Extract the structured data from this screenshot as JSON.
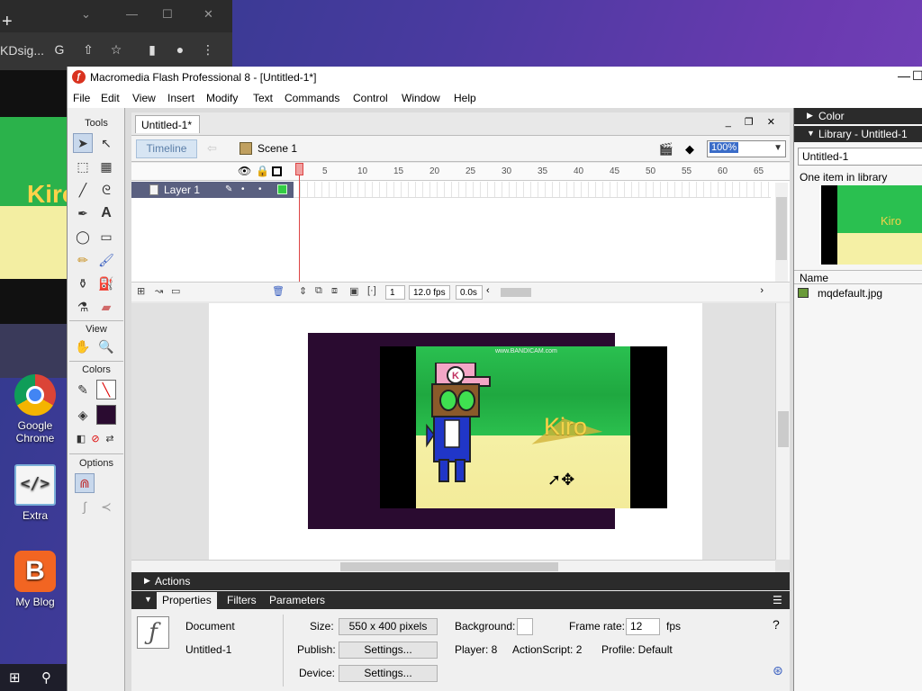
{
  "browser": {
    "url_fragment": "KDsig...",
    "new_tab": "+"
  },
  "desktop": {
    "icons": [
      {
        "label": "Google Chrome"
      },
      {
        "label": "Extra"
      },
      {
        "label": "My Blog"
      }
    ]
  },
  "window": {
    "title": "Macromedia Flash Professional 8 - [Untitled-1*]"
  },
  "menu": [
    "File",
    "Edit",
    "View",
    "Insert",
    "Modify",
    "Text",
    "Commands",
    "Control",
    "Window",
    "Help"
  ],
  "tools": {
    "header": "Tools",
    "view_header": "View",
    "colors_header": "Colors",
    "options_header": "Options"
  },
  "document": {
    "tab": "Untitled-1*",
    "timeline_button": "Timeline",
    "scene": "Scene 1",
    "zoom": "100%"
  },
  "timeline": {
    "ruler": [
      "5",
      "10",
      "15",
      "20",
      "25",
      "30",
      "35",
      "40",
      "45",
      "50",
      "55",
      "60",
      "65"
    ],
    "layer_name": "Layer 1",
    "current_frame": "1",
    "frame_rate": "12.0 fps",
    "elapsed": "0.0s"
  },
  "stage": {
    "watermark": "www.BANDICAM.com",
    "video_text": "Kiro"
  },
  "panels": {
    "actions": "Actions",
    "tabs": [
      "Properties",
      "Filters",
      "Parameters"
    ]
  },
  "properties": {
    "doc_label": "Document",
    "doc_name": "Untitled-1",
    "size_label": "Size:",
    "size_value": "550 x 400 pixels",
    "background_label": "Background:",
    "frame_rate_label": "Frame rate:",
    "frame_rate_value": "12",
    "fps_label": "fps",
    "publish_label": "Publish:",
    "settings_button": "Settings...",
    "player_label": "Player: 8",
    "actionscript_label": "ActionScript:  2",
    "profile_label": "Profile:  Default",
    "device_label": "Device:",
    "device_button": "Settings..."
  },
  "right_panels": {
    "color": "Color",
    "library": "Library - Untitled-1",
    "library_select": "Untitled-1",
    "item_count": "One item in library",
    "name_header": "Name",
    "item": "mqdefault.jpg",
    "preview_text": "Kiro"
  },
  "colors": {
    "stage_bg": "#2a0b30",
    "panel_dark": "#2b2b2b",
    "layer_selected": "#5a6080"
  }
}
